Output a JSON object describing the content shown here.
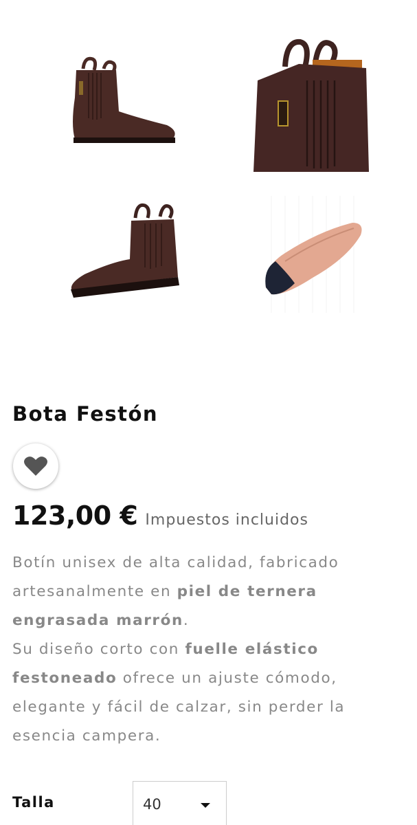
{
  "product": {
    "title": "Bota Festón",
    "price": "123,00 €",
    "tax_note": "Impuestos incluidos",
    "description": {
      "p1_a": "Botín unisex de alta calidad, fabricado artesanalmente en ",
      "p1_b": "piel de ternera engrasada marrón",
      "p1_c": ".",
      "p2_a": "Su diseño corto con ",
      "p2_b": "fuelle elástico festoneado",
      "p2_c": " ofrece un ajuste cómodo, elegante y fácil de calzar, sin perder la esencia campera."
    }
  },
  "gallery": {
    "images": [
      {
        "name": "boot-side-view",
        "icon": "boot-image"
      },
      {
        "name": "boot-detail-view",
        "icon": "boot-image"
      },
      {
        "name": "boot-three-quarter-view",
        "icon": "boot-image"
      },
      {
        "name": "boot-sole-view",
        "icon": "sole-image"
      }
    ]
  },
  "wishlist": {
    "icon": "heart-icon"
  },
  "options": {
    "size_label": "Talla",
    "size_selected": "40"
  },
  "colors": {
    "leather": "#4a2a25",
    "leather_dark": "#321b18",
    "heart": "#555555",
    "text_muted": "#888888"
  }
}
